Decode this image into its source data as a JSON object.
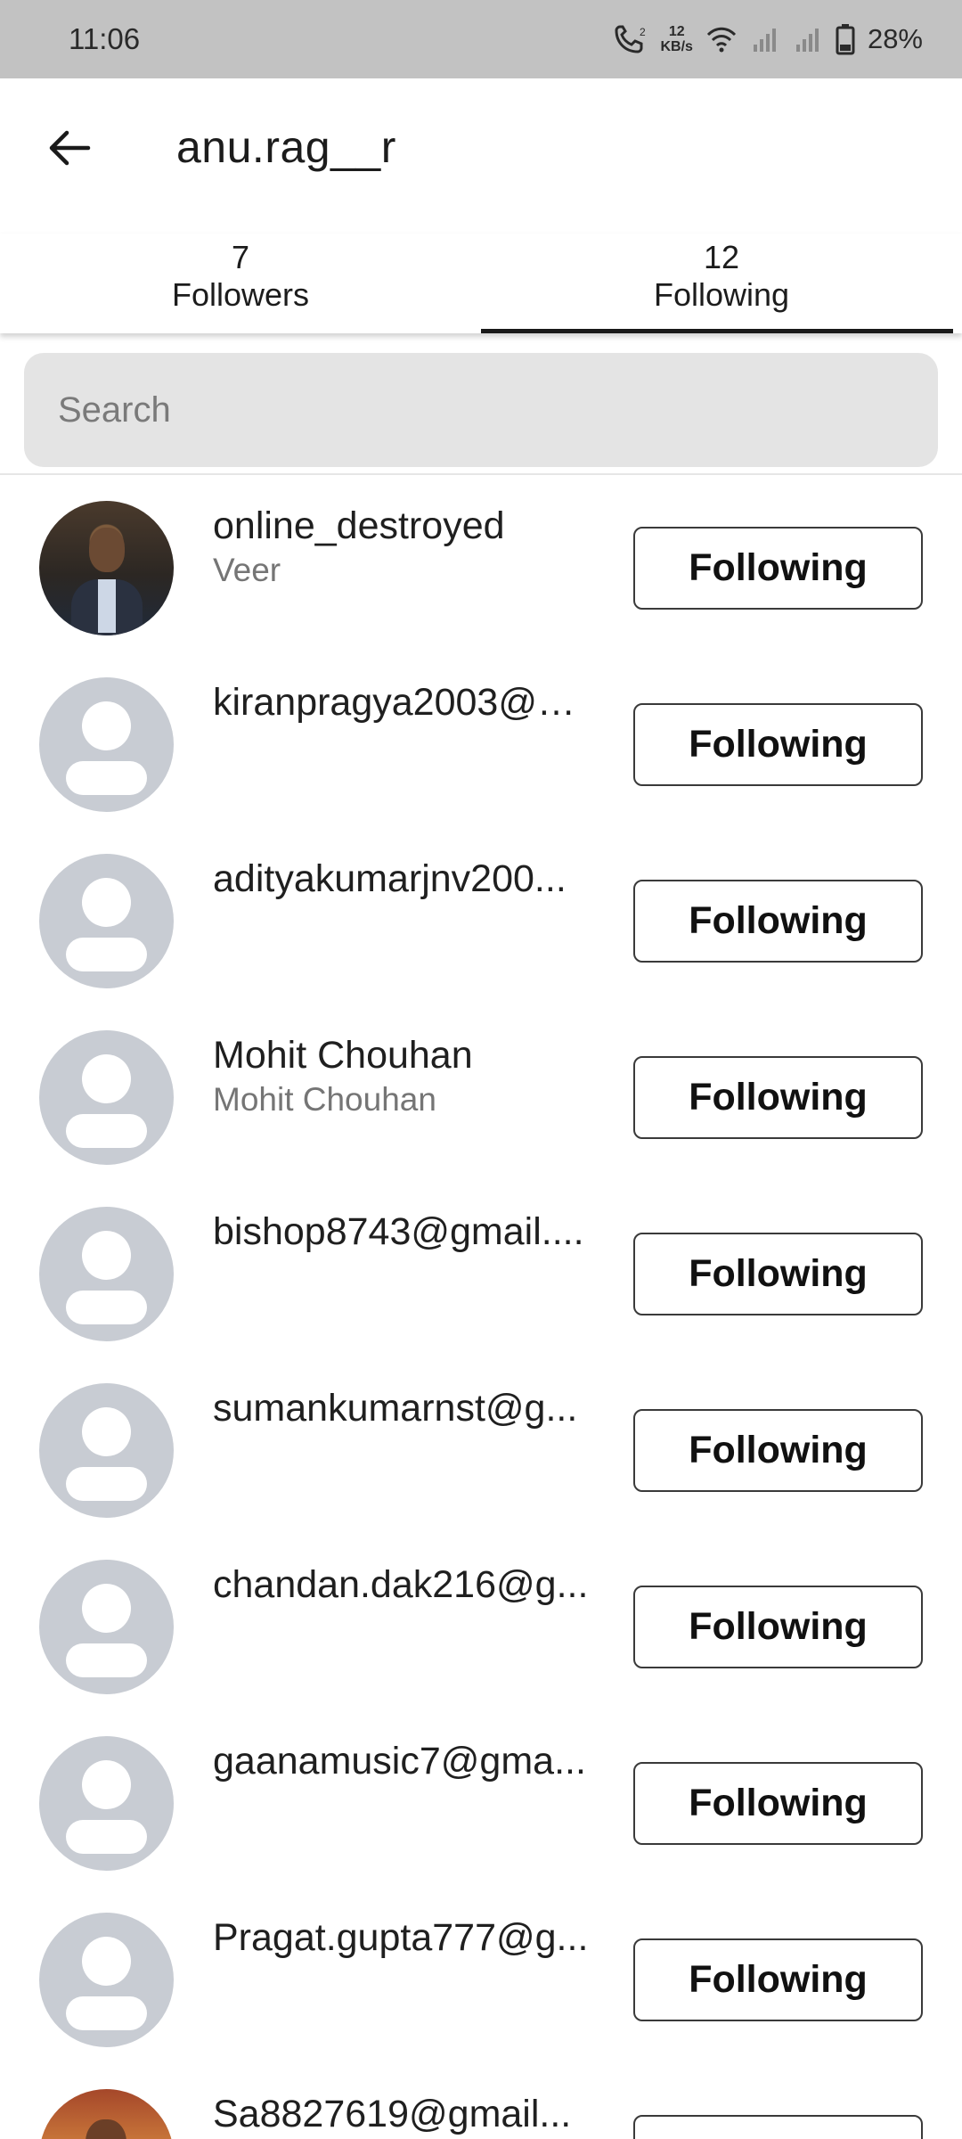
{
  "status_bar": {
    "time": "11:06",
    "speed_value": "12",
    "speed_unit": "KB/s",
    "battery": "28%",
    "icons": [
      "call-icon",
      "wifi-icon",
      "signal-icon",
      "signal-icon",
      "battery-icon"
    ]
  },
  "header": {
    "title": "anu.rag__r"
  },
  "tabs": [
    {
      "count": "7",
      "label": "Followers",
      "active": false
    },
    {
      "count": "12",
      "label": "Following",
      "active": true
    }
  ],
  "search": {
    "placeholder": "Search",
    "value": ""
  },
  "users": [
    {
      "handle": "online_destroyed",
      "name": "Veer",
      "button": "Following",
      "avatar": "photo"
    },
    {
      "handle": "kiranpragya2003@g...",
      "name": "",
      "button": "Following",
      "avatar": "default"
    },
    {
      "handle": "adityakumarjnv200...",
      "name": "",
      "button": "Following",
      "avatar": "default"
    },
    {
      "handle": "Mohit Chouhan",
      "name": "Mohit Chouhan",
      "button": "Following",
      "avatar": "default"
    },
    {
      "handle": "bishop8743@gmail....",
      "name": "",
      "button": "Following",
      "avatar": "default"
    },
    {
      "handle": "sumankumarnst@g...",
      "name": "",
      "button": "Following",
      "avatar": "default"
    },
    {
      "handle": "chandan.dak216@g...",
      "name": "",
      "button": "Following",
      "avatar": "default"
    },
    {
      "handle": "gaanamusic7@gma...",
      "name": "",
      "button": "Following",
      "avatar": "default"
    },
    {
      "handle": "Pragat.gupta777@g...",
      "name": "",
      "button": "Following",
      "avatar": "default"
    },
    {
      "handle": "Sa8827619@gmail...",
      "name": "",
      "button": "Following",
      "avatar": "photo"
    }
  ],
  "colors": {
    "status_bar_bg": "#c2c2c2",
    "search_bg": "#e4e4e4",
    "avatar_placeholder": "#c8ccd3",
    "tab_indicator": "#1a1a1a"
  }
}
